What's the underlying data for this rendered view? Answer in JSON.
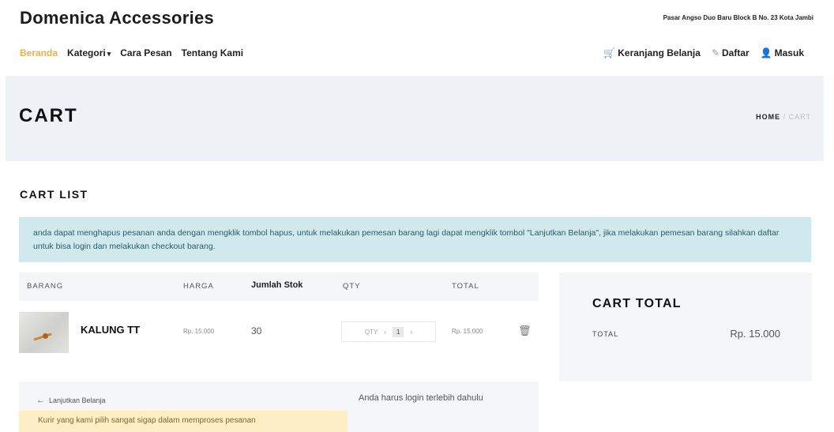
{
  "header": {
    "brand": "Domenica Accessories",
    "address": "Pasar Angso Duo Baru Block B No. 23 Kota Jambi"
  },
  "nav": {
    "items": [
      "Beranda",
      "Kategori",
      "Cara Pesan",
      "Tentang Kami"
    ],
    "kategori_caret": "▾",
    "right": {
      "cart_icon": "🛒",
      "cart": "Keranjang Belanja",
      "daftar_icon": "✎",
      "daftar": "Daftar",
      "masuk_icon": "👤",
      "masuk": "Masuk"
    }
  },
  "hero": {
    "title": "CART",
    "breadcrumb": {
      "home": "HOME",
      "sep": "/",
      "current": "CART"
    }
  },
  "cart": {
    "section_title": "CART LIST",
    "info": "anda dapat menghapus pesanan anda dengan mengklik tombol hapus, untuk melakukan pemesan barang lagi dapat mengklik tombol \"Lanjutkan Belanja\", jika melakukan pemesan barang silahkan daftar untuk bisa login dan melakukan checkout barang.",
    "columns": {
      "barang": "BARANG",
      "harga": "HARGA",
      "stok": "Jumlah Stok",
      "qty": "QTY",
      "total": "TOTAL"
    },
    "items": [
      {
        "name": "KALUNG TT",
        "price": "Rp. 15.000",
        "stock": "30",
        "qty_label": "QTY",
        "qty_minus": "‹",
        "qty_value": "1",
        "qty_plus": "›",
        "total": "Rp. 15.000",
        "delete_icon": "🗑"
      }
    ]
  },
  "summary": {
    "title": "CART TOTAL",
    "total_label": "TOTAL",
    "total_value": "Rp. 15.000"
  },
  "footer": {
    "back_arrow": "←",
    "back": "Lanjutkan Belanja",
    "login_note": "Anda harus login terlebih dahulu",
    "warning": "Kurir yang kami pilih sangat sigap dalam memproses pesanan"
  },
  "colors": {
    "accent": "#e8b24a",
    "info_bg": "#cfe9ef",
    "warning_bg": "#fdeec6",
    "panel_bg": "#f4f6f8"
  }
}
